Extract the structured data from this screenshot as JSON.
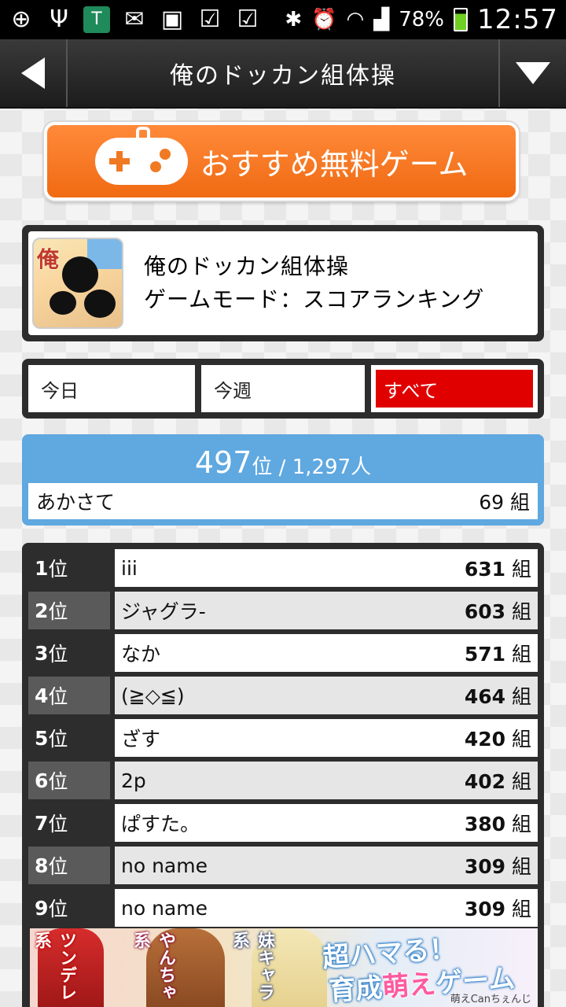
{
  "status_bar": {
    "battery": "78%",
    "time": "12:57"
  },
  "titlebar": {
    "title": "俺のドッカン組体操"
  },
  "promo": {
    "label": "おすすめ無料ゲーム"
  },
  "game": {
    "name": "俺のドッカン組体操",
    "mode": "ゲームモード：スコアランキング",
    "icon_label": "俺"
  },
  "tabs": [
    {
      "label": "今日",
      "selected": false
    },
    {
      "label": "今週",
      "selected": false
    },
    {
      "label": "すべて",
      "selected": true
    }
  ],
  "my_rank": {
    "rank": "497",
    "rank_unit": "位",
    "separator": " / ",
    "total": "1,297人",
    "name": "あかさて",
    "score": "69",
    "score_unit": "組"
  },
  "ranking": [
    {
      "rank": "1",
      "unit": "位",
      "name": "iii",
      "score": "631",
      "score_unit": "組"
    },
    {
      "rank": "2",
      "unit": "位",
      "name": "ジャグラ-",
      "score": "603",
      "score_unit": "組"
    },
    {
      "rank": "3",
      "unit": "位",
      "name": "なか",
      "score": "571",
      "score_unit": "組"
    },
    {
      "rank": "4",
      "unit": "位",
      "name": "(≧◇≦)",
      "score": "464",
      "score_unit": "組"
    },
    {
      "rank": "5",
      "unit": "位",
      "name": "ざす",
      "score": "420",
      "score_unit": "組"
    },
    {
      "rank": "6",
      "unit": "位",
      "name": "2p",
      "score": "402",
      "score_unit": "組"
    },
    {
      "rank": "7",
      "unit": "位",
      "name": "ぱすた。",
      "score": "380",
      "score_unit": "組"
    },
    {
      "rank": "8",
      "unit": "位",
      "name": "no name",
      "score": "309",
      "score_unit": "組"
    },
    {
      "rank": "9",
      "unit": "位",
      "name": "no name",
      "score": "309",
      "score_unit": "組"
    }
  ],
  "ad": {
    "tag1": "ツンデレ系",
    "tag2": "やんちゃ系",
    "tag3": "妹キャラ系",
    "slogan_line1": "超ハマる！",
    "slogan_line2a": "育成",
    "slogan_line2b": "萌え",
    "slogan_line2c": "ゲーム",
    "credit": "萌えCanちぇんじ"
  },
  "colors": {
    "accent_orange": "#f06a12",
    "selected_tab_red": "#e00000",
    "my_rank_blue": "#5fa8e0",
    "battery_green": "#6fcf22"
  }
}
